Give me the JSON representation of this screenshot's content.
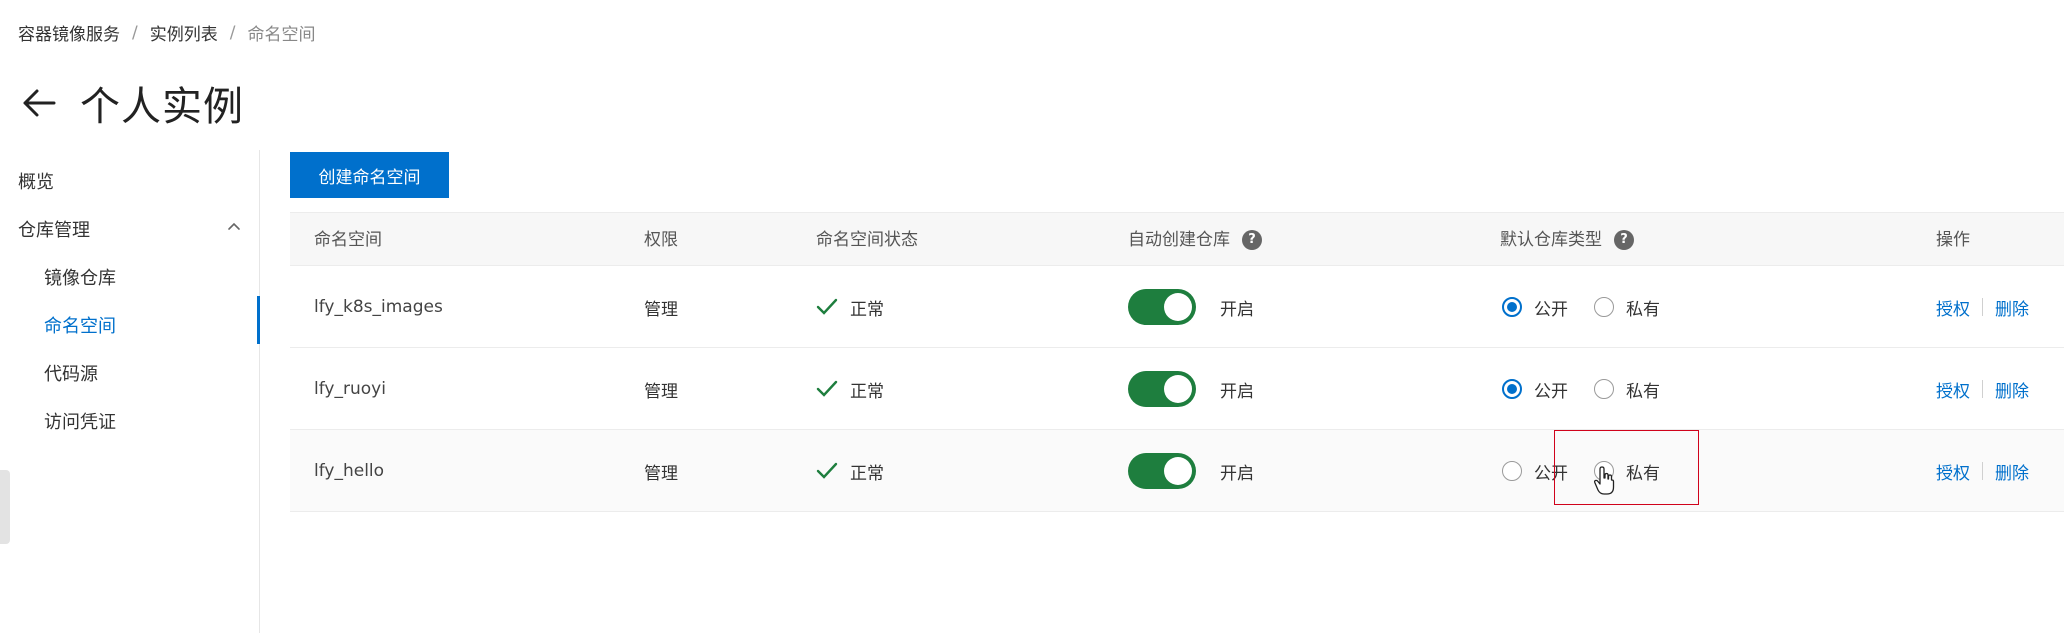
{
  "breadcrumb": {
    "items": [
      "容器镜像服务",
      "实例列表",
      "命名空间"
    ],
    "separator": "/"
  },
  "page": {
    "title": "个人实例",
    "back_icon": "arrow-left-icon"
  },
  "sidebar": {
    "overview": "概览",
    "repo_mgmt": "仓库管理",
    "items": [
      {
        "label": "镜像仓库"
      },
      {
        "label": "命名空间"
      },
      {
        "label": "代码源"
      },
      {
        "label": "访问凭证"
      }
    ],
    "active": "命名空间"
  },
  "toolbar": {
    "create_label": "创建命名空间"
  },
  "table": {
    "headers": {
      "namespace": "命名空间",
      "permission": "权限",
      "status": "命名空间状态",
      "auto_create": "自动创建仓库",
      "default_type": "默认仓库类型",
      "actions": "操作"
    },
    "help_glyph": "?",
    "rows": [
      {
        "name": "lfy_k8s_images",
        "permission": "管理",
        "status": "正常",
        "auto_create": "开启",
        "public": "公开",
        "private": "私有",
        "selected": "public",
        "grant": "授权",
        "delete": "删除"
      },
      {
        "name": "lfy_ruoyi",
        "permission": "管理",
        "status": "正常",
        "auto_create": "开启",
        "public": "公开",
        "private": "私有",
        "selected": "public",
        "grant": "授权",
        "delete": "删除"
      },
      {
        "name": "lfy_hello",
        "permission": "管理",
        "status": "正常",
        "auto_create": "开启",
        "public": "公开",
        "private": "私有",
        "selected": "none",
        "grant": "授权",
        "delete": "删除"
      }
    ]
  },
  "colors": {
    "primary": "#0070cc",
    "switch_on": "#1e7e3e",
    "status_ok": "#1e7e3e",
    "highlight": "#d0021b"
  }
}
